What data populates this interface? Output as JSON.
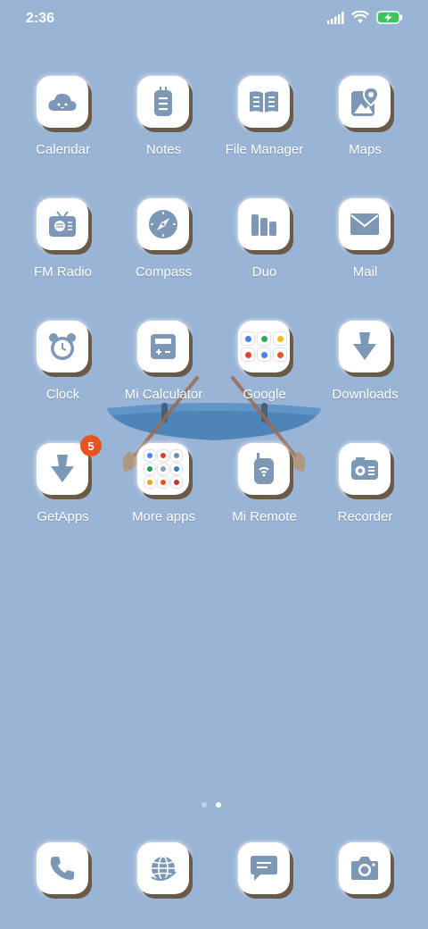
{
  "status_bar": {
    "time": "2:36"
  },
  "apps": [
    [
      {
        "name": "calendar",
        "label": "Calendar"
      },
      {
        "name": "notes",
        "label": "Notes"
      },
      {
        "name": "file-manager",
        "label": "File Manager"
      },
      {
        "name": "maps",
        "label": "Maps"
      }
    ],
    [
      {
        "name": "fm-radio",
        "label": "FM Radio"
      },
      {
        "name": "compass",
        "label": "Compass"
      },
      {
        "name": "duo",
        "label": "Duo"
      },
      {
        "name": "mail",
        "label": "Mail"
      }
    ],
    [
      {
        "name": "clock",
        "label": "Clock"
      },
      {
        "name": "mi-calculator",
        "label": "Mi Calculator"
      },
      {
        "name": "google-folder",
        "label": "Google"
      },
      {
        "name": "downloads",
        "label": "Downloads"
      }
    ],
    [
      {
        "name": "getapps",
        "label": "GetApps",
        "badge": "5"
      },
      {
        "name": "more-apps-folder",
        "label": "More apps"
      },
      {
        "name": "mi-remote",
        "label": "Mi Remote"
      },
      {
        "name": "recorder",
        "label": "Recorder"
      }
    ]
  ],
  "page_indicator": {
    "count": 2,
    "active": 2
  },
  "dock": [
    "phone",
    "browser",
    "messages",
    "camera"
  ],
  "colors": {
    "wallpaper": "#9ab4d6",
    "icon_glyph": "#7d97b7",
    "badge": "#e8541f",
    "battery": "#3ec25b"
  }
}
